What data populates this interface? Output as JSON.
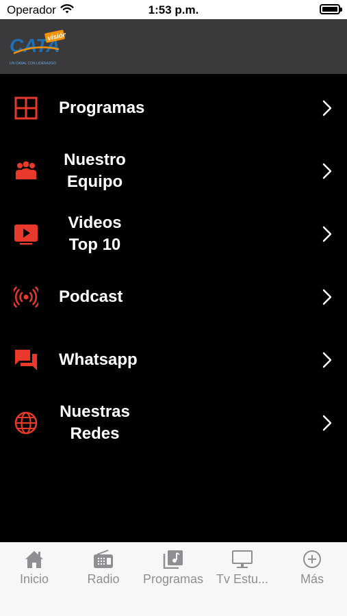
{
  "status_bar": {
    "carrier": "Operador",
    "time": "1:53 p.m."
  },
  "header": {
    "logo": {
      "brand_text": "CATA",
      "brand_suffix": "visión",
      "tagline": "UN CANAL CON LIDERAZGO"
    }
  },
  "menu": {
    "items": [
      {
        "label": "Programas",
        "icon": "grid-icon"
      },
      {
        "label": "Nuestro Equipo",
        "icon": "group-icon"
      },
      {
        "label": "Videos Top 10",
        "icon": "play-video-icon"
      },
      {
        "label": "Podcast",
        "icon": "broadcast-icon"
      },
      {
        "label": "Whatsapp",
        "icon": "chat-bubbles-icon"
      },
      {
        "label": "Nuestras Redes",
        "icon": "globe-icon"
      }
    ]
  },
  "tab_bar": {
    "tabs": [
      {
        "label": "Inicio",
        "icon": "home-icon"
      },
      {
        "label": "Radio",
        "icon": "radio-icon"
      },
      {
        "label": "Programas",
        "icon": "music-library-icon"
      },
      {
        "label": "Tv  Estu...",
        "icon": "tv-monitor-icon"
      },
      {
        "label": "Más",
        "icon": "plus-circle-icon"
      }
    ]
  },
  "colors": {
    "accent": "#e8392b",
    "menu_background": "#000000",
    "header_background": "#3a3a3c",
    "tab_inactive": "#8e8e93",
    "logo_blue": "#1f6fb5",
    "logo_orange": "#f39200"
  }
}
